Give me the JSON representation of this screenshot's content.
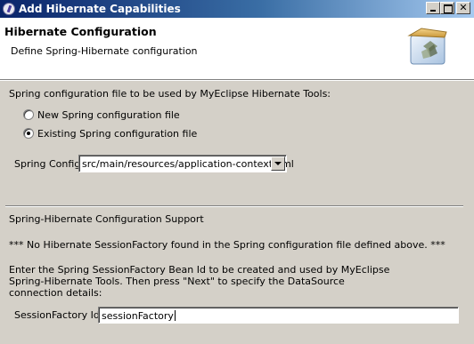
{
  "window": {
    "title": "Add Hibernate Capabilities",
    "controls": [
      "minimize",
      "maximize",
      "close"
    ]
  },
  "header": {
    "title": "Hibernate Configuration",
    "subtitle": "Define Spring-Hibernate configuration",
    "image_icon": "hibernate-wizard-icon"
  },
  "spring_config_section": {
    "prompt": "Spring configuration file to be used by MyEclipse Hibernate Tools:",
    "options": [
      {
        "label": "New Spring configuration file",
        "selected": false
      },
      {
        "label": "Existing Spring configuration file",
        "selected": true
      }
    ],
    "spring_config_label": "Spring Config:",
    "spring_config_value": "src/main/resources/application-context.xml"
  },
  "support_section": {
    "heading": "Spring-Hibernate Configuration Support",
    "warning": "*** No Hibernate SessionFactory found in the Spring configuration file defined above. ***",
    "instructions": [
      "Enter the Spring SessionFactory Bean Id to be created and used by MyEclipse",
      "Spring-Hibernate Tools. Then press \"Next\" to specify the DataSource",
      "connection details:"
    ],
    "session_factory_label": "SessionFactory Id:",
    "session_factory_value": "sessionFactory"
  },
  "colors": {
    "titlebar_start": "#0a246a",
    "titlebar_end": "#a6caf0",
    "dialog_bg": "#d4d0c8",
    "header_bg": "#ffffff"
  }
}
